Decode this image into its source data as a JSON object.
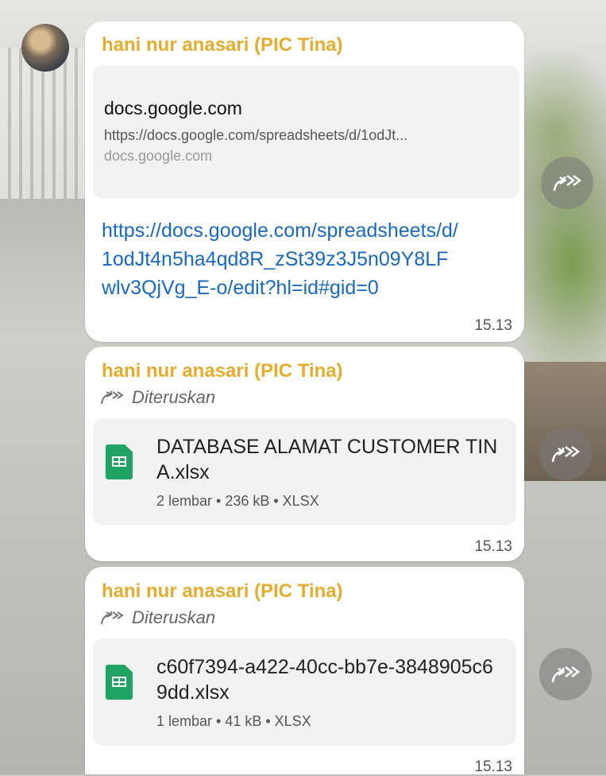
{
  "messages": [
    {
      "sender": "hani nur anasari (PIC Tina)",
      "preview": {
        "title": "docs.google.com",
        "url": "https://docs.google.com/spreadsheets/d/1odJt...",
        "domain": "docs.google.com"
      },
      "link": "https://docs.google.com/spreadsheets/d/1odJt4n5ha4qd8R_zSt39z3J5n09Y8LFwlv3QjVg_E-o/edit?hl=id#gid=0",
      "time": "15.13"
    },
    {
      "sender": "hani nur anasari (PIC Tina)",
      "forwarded_label": "Diteruskan",
      "file": {
        "name": "DATABASE ALAMAT CUSTOMER TINA.xlsx",
        "meta": "2 lembar • 236 kB • XLSX"
      },
      "time": "15.13"
    },
    {
      "sender": "hani nur anasari (PIC Tina)",
      "forwarded_label": "Diteruskan",
      "file": {
        "name": "c60f7394-a422-40cc-bb7e-3848905c69dd.xlsx",
        "meta": "1 lembar • 41 kB • XLSX"
      },
      "time": "15.13"
    }
  ],
  "icons": {
    "avatar": "avatar",
    "forward": "forward-icon",
    "share": "share-icon",
    "file": "spreadsheet-file-icon"
  },
  "colors": {
    "sender": "#e6ac2e",
    "link": "#1769c2",
    "sheet_icon": "#1fa463"
  }
}
